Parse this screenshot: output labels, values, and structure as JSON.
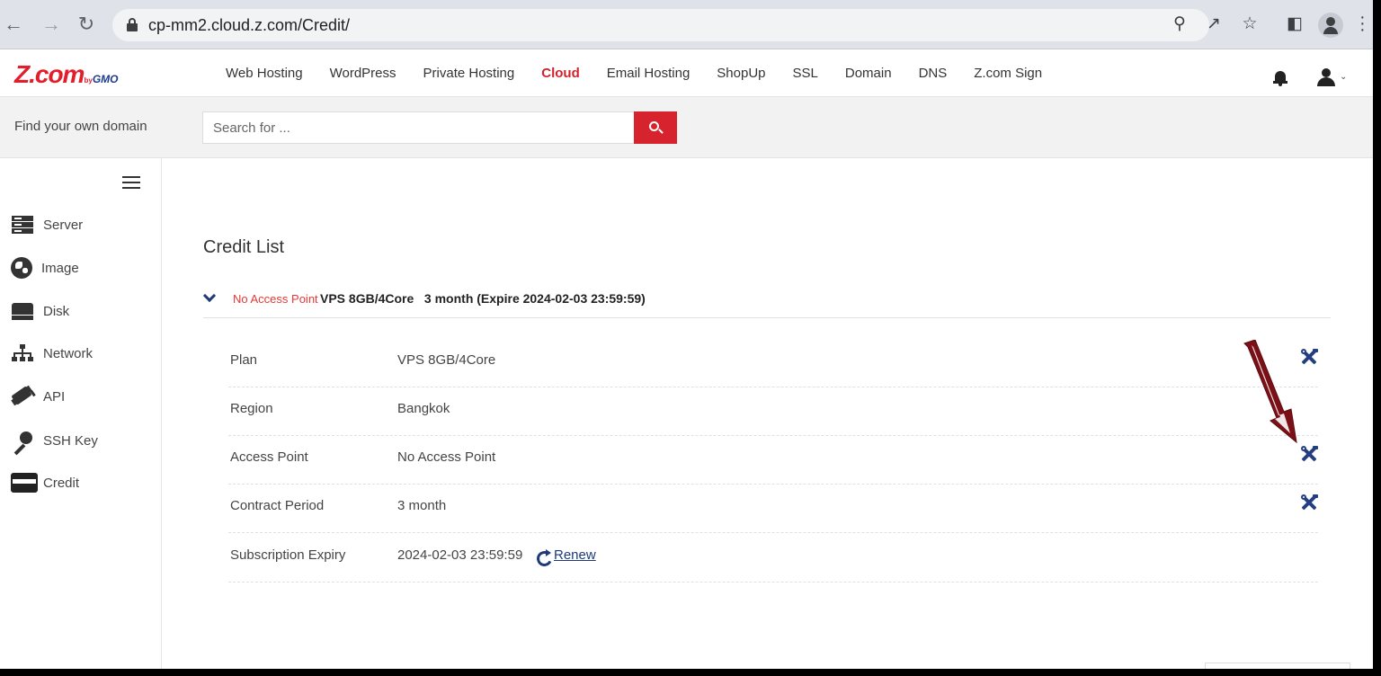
{
  "browser": {
    "url": "cp-mm2.cloud.z.com/Credit/",
    "icons": [
      "back-icon",
      "forward-icon",
      "reload-icon",
      "lock-icon",
      "zoom-icon",
      "share-icon",
      "star-icon",
      "sidepanel-icon",
      "profile-icon",
      "menu-icon"
    ]
  },
  "site": {
    "logo_text": "Z.com",
    "logo_by": "by",
    "logo_gmo": "GMO",
    "nav": [
      {
        "label": "Web Hosting"
      },
      {
        "label": "WordPress"
      },
      {
        "label": "Private Hosting"
      },
      {
        "label": "Cloud",
        "active": true
      },
      {
        "label": "Email Hosting"
      },
      {
        "label": "ShopUp"
      },
      {
        "label": "SSL"
      },
      {
        "label": "Domain"
      },
      {
        "label": "DNS"
      },
      {
        "label": "Z.com Sign"
      }
    ],
    "active_color": "#d2222d"
  },
  "search": {
    "label": "Find your own domain",
    "placeholder": "Search for ...",
    "button_color": "#d7232e"
  },
  "sidebar": {
    "items": [
      {
        "label": "Server",
        "icon": "server-icon"
      },
      {
        "label": "Image",
        "icon": "image-icon"
      },
      {
        "label": "Disk",
        "icon": "disk-icon"
      },
      {
        "label": "Network",
        "icon": "network-icon"
      },
      {
        "label": "API",
        "icon": "api-icon"
      },
      {
        "label": "SSH Key",
        "icon": "key-icon"
      },
      {
        "label": "Credit",
        "icon": "credit-card-icon"
      }
    ]
  },
  "main": {
    "title": "Credit List",
    "credit": {
      "badge": "No Access Point",
      "summary": "VPS 8GB/4Core   3 month (Expire 2024-02-03 23:59:59)",
      "rows": [
        {
          "key": "Plan",
          "value": "VPS 8GB/4Core",
          "editable": true
        },
        {
          "key": "Region",
          "value": "Bangkok",
          "editable": false
        },
        {
          "key": "Access Point",
          "value": "No Access Point",
          "editable": true
        },
        {
          "key": "Contract Period",
          "value": "3 month",
          "editable": true
        },
        {
          "key": "Subscription Expiry",
          "value": "2024-02-03 23:59:59",
          "editable": false
        }
      ],
      "renew_label": "Renew"
    },
    "accent_color": "#1f3a7a",
    "badge_color": "#e53935",
    "annotation_arrow_color": "#7b1116"
  }
}
